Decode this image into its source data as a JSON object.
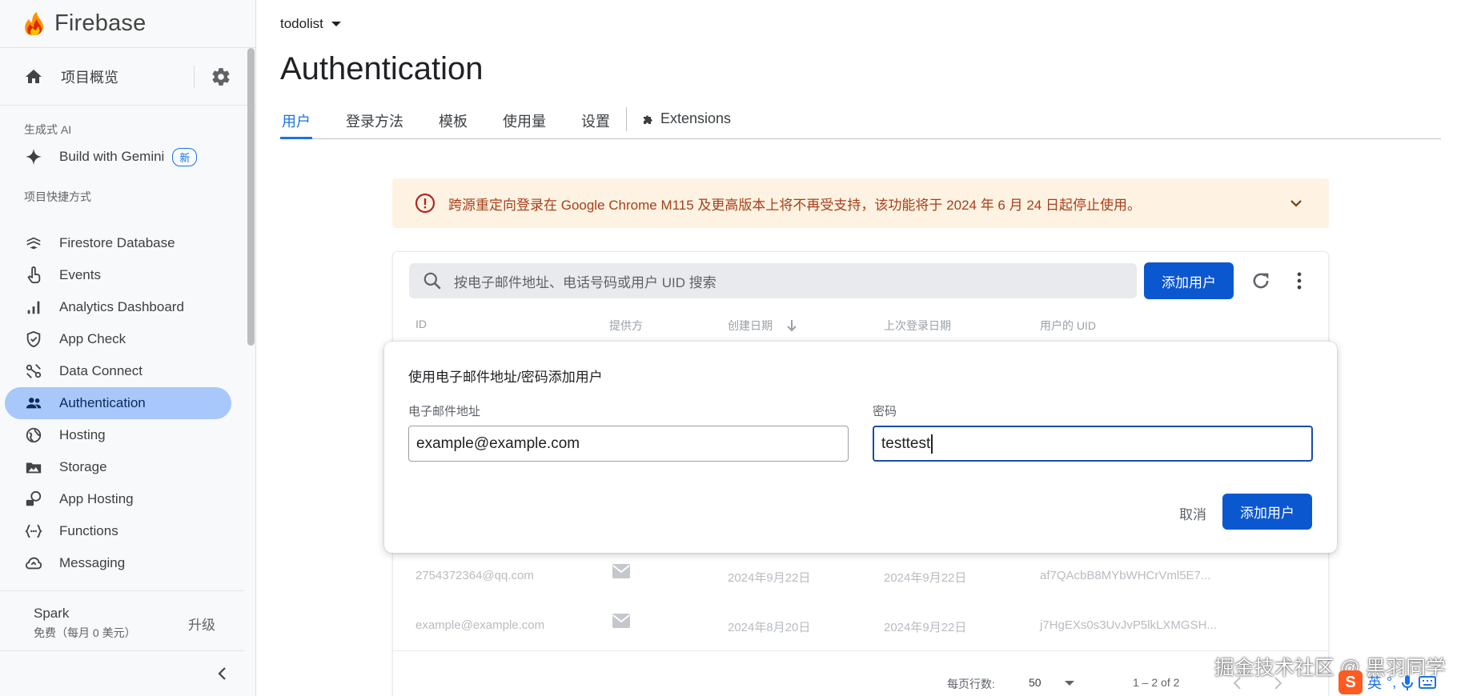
{
  "sidebar": {
    "brand": "Firebase",
    "overview": "项目概览",
    "section_ai": "生成式 AI",
    "gemini": {
      "label": "Build with Gemini",
      "badge": "新"
    },
    "section_shortcuts": "项目快捷方式",
    "items": [
      {
        "label": "Firestore Database",
        "icon": "firestore-icon"
      },
      {
        "label": "Events",
        "icon": "events-icon"
      },
      {
        "label": "Analytics Dashboard",
        "icon": "analytics-icon"
      },
      {
        "label": "App Check",
        "icon": "app-check-icon"
      },
      {
        "label": "Data Connect",
        "icon": "data-connect-icon"
      },
      {
        "label": "Authentication",
        "icon": "people-icon",
        "active": true
      },
      {
        "label": "Hosting",
        "icon": "globe-icon"
      },
      {
        "label": "Storage",
        "icon": "image-icon"
      },
      {
        "label": "App Hosting",
        "icon": "app-hosting-icon"
      },
      {
        "label": "Functions",
        "icon": "functions-icon"
      },
      {
        "label": "Messaging",
        "icon": "cloud-icon"
      }
    ],
    "plan": {
      "name": "Spark",
      "sub": "免费（每月 0 美元）",
      "upgrade": "升级"
    }
  },
  "header": {
    "project": "todolist",
    "title": "Authentication",
    "tabs": [
      "用户",
      "登录方法",
      "模板",
      "使用量",
      "设置"
    ],
    "extensions": "Extensions"
  },
  "banner": {
    "message": "跨源重定向登录在 Google Chrome M115 及更高版本上将不再受支持，该功能将于 2024 年 6 月 24 日起停止使用。"
  },
  "table": {
    "search_placeholder": "按电子邮件地址、电话号码或用户 UID 搜索",
    "add_user": "添加用户",
    "columns": [
      "ID",
      "提供方",
      "创建日期",
      "上次登录日期",
      "用户的 UID"
    ],
    "rows": [
      {
        "id": "2754372364@qq.com",
        "created": "2024年9月22日",
        "last_login": "2024年9月22日",
        "uid": "af7QAcbB8MYbWHCrVml5E7..."
      },
      {
        "id": "example@example.com",
        "created": "2024年8月20日",
        "last_login": "2024年9月22日",
        "uid": "j7HgEXs0s3UvJvP5lkLXMGSH..."
      }
    ],
    "pager": {
      "rows_label": "每页行数:",
      "rows_value": "50",
      "range": "1 – 2 of 2"
    }
  },
  "modal": {
    "title": "使用电子邮件地址/密码添加用户",
    "email_label": "电子邮件地址",
    "email_value": "example@example.com",
    "password_label": "密码",
    "password_value": "testtest",
    "cancel": "取消",
    "submit": "添加用户"
  },
  "overlay": {
    "watermark": "掘金技术社区 @ 黑羽同学",
    "ime_lang": "英"
  },
  "colors": {
    "accent": "#1a73e8",
    "primary_button": "#0b57d0",
    "active_nav": "#a8c7fa",
    "banner_bg": "#fef3e2",
    "banner_text": "#a83e1b"
  }
}
